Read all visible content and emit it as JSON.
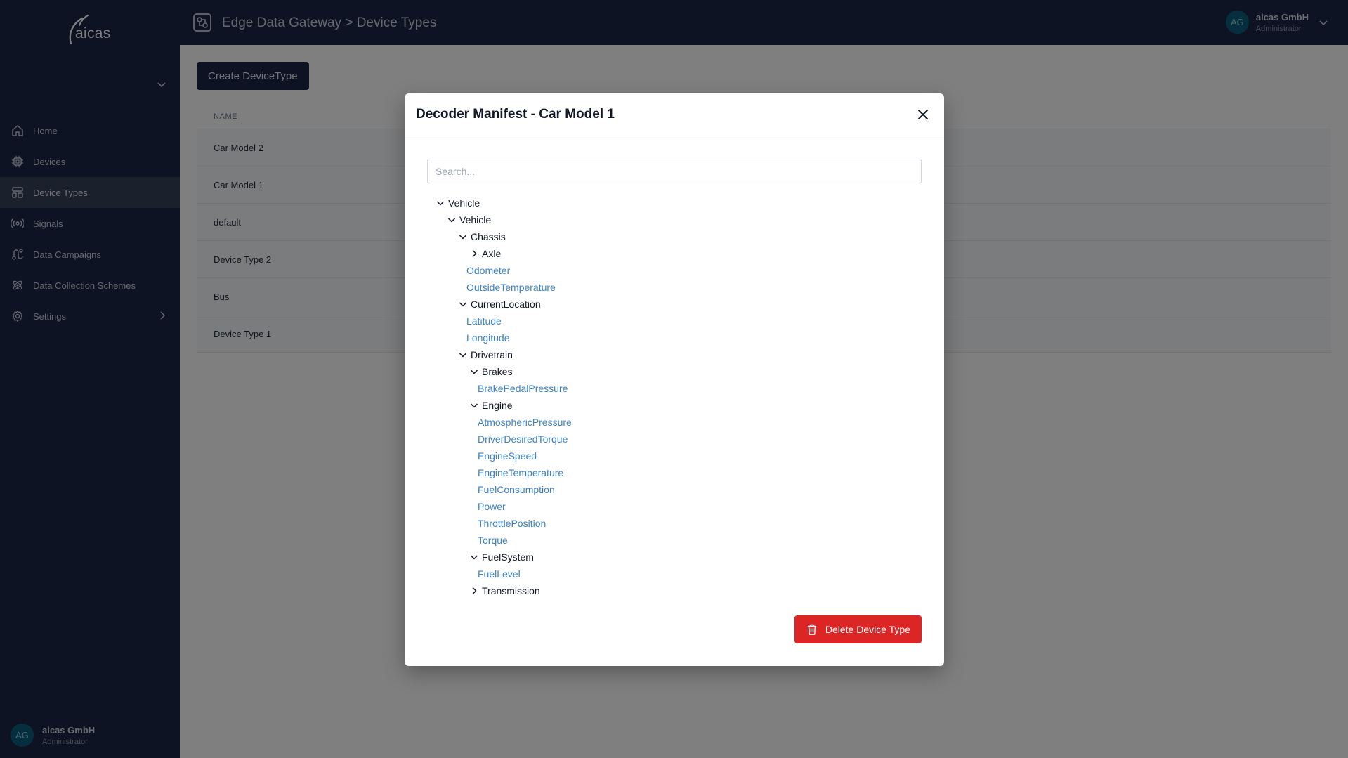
{
  "app": {
    "logo_text": "aicas",
    "header_title": "Edge Data Gateway > Device Types"
  },
  "user": {
    "initials": "AG",
    "name": "aicas GmbH",
    "role": "Administrator"
  },
  "sidebar": {
    "items": [
      {
        "label": "Home",
        "icon": "home-icon"
      },
      {
        "label": "Devices",
        "icon": "chip-icon"
      },
      {
        "label": "Device Types",
        "icon": "layout-icon"
      },
      {
        "label": "Signals",
        "icon": "broadcast-icon"
      },
      {
        "label": "Data Campaigns",
        "icon": "route-icon"
      },
      {
        "label": "Data Collection Schemes",
        "icon": "atom-icon"
      },
      {
        "label": "Settings",
        "icon": "gear-icon"
      }
    ],
    "active_label": "Device Types"
  },
  "main": {
    "create_label": "Create DeviceType",
    "table": {
      "header": "NAME",
      "rows": [
        "Car Model 2",
        "Car Model 1",
        "default",
        "Device Type 2",
        "Bus",
        "Device Type 1"
      ]
    }
  },
  "modal": {
    "title": "Decoder Manifest - Car Model 1",
    "search_placeholder": "Search...",
    "delete_label": "Delete Device Type",
    "tree": [
      {
        "label": "Vehicle",
        "depth": 0,
        "kind": "node",
        "expanded": true
      },
      {
        "label": "Vehicle",
        "depth": 1,
        "kind": "node",
        "expanded": true
      },
      {
        "label": "Chassis",
        "depth": 2,
        "kind": "node",
        "expanded": true
      },
      {
        "label": "Axle",
        "depth": 3,
        "kind": "node",
        "expanded": false
      },
      {
        "label": "Odometer",
        "depth": 3,
        "kind": "leaf"
      },
      {
        "label": "OutsideTemperature",
        "depth": 3,
        "kind": "leaf"
      },
      {
        "label": "CurrentLocation",
        "depth": 2,
        "kind": "node",
        "expanded": true
      },
      {
        "label": "Latitude",
        "depth": 3,
        "kind": "leaf"
      },
      {
        "label": "Longitude",
        "depth": 3,
        "kind": "leaf"
      },
      {
        "label": "Drivetrain",
        "depth": 2,
        "kind": "node",
        "expanded": true
      },
      {
        "label": "Brakes",
        "depth": 3,
        "kind": "node",
        "expanded": true
      },
      {
        "label": "BrakePedalPressure",
        "depth": 4,
        "kind": "leaf"
      },
      {
        "label": "Engine",
        "depth": 3,
        "kind": "node",
        "expanded": true
      },
      {
        "label": "AtmosphericPressure",
        "depth": 4,
        "kind": "leaf"
      },
      {
        "label": "DriverDesiredTorque",
        "depth": 4,
        "kind": "leaf"
      },
      {
        "label": "EngineSpeed",
        "depth": 4,
        "kind": "leaf"
      },
      {
        "label": "EngineTemperature",
        "depth": 4,
        "kind": "leaf"
      },
      {
        "label": "FuelConsumption",
        "depth": 4,
        "kind": "leaf"
      },
      {
        "label": "Power",
        "depth": 4,
        "kind": "leaf"
      },
      {
        "label": "ThrottlePosition",
        "depth": 4,
        "kind": "leaf"
      },
      {
        "label": "Torque",
        "depth": 4,
        "kind": "leaf"
      },
      {
        "label": "FuelSystem",
        "depth": 3,
        "kind": "node",
        "expanded": true
      },
      {
        "label": "FuelLevel",
        "depth": 4,
        "kind": "leaf"
      },
      {
        "label": "Transmission",
        "depth": 3,
        "kind": "node",
        "expanded": false
      }
    ]
  },
  "colors": {
    "sidebar_bg": "#1b2746",
    "accent_link": "#3b82c4",
    "danger": "#dc2626"
  }
}
